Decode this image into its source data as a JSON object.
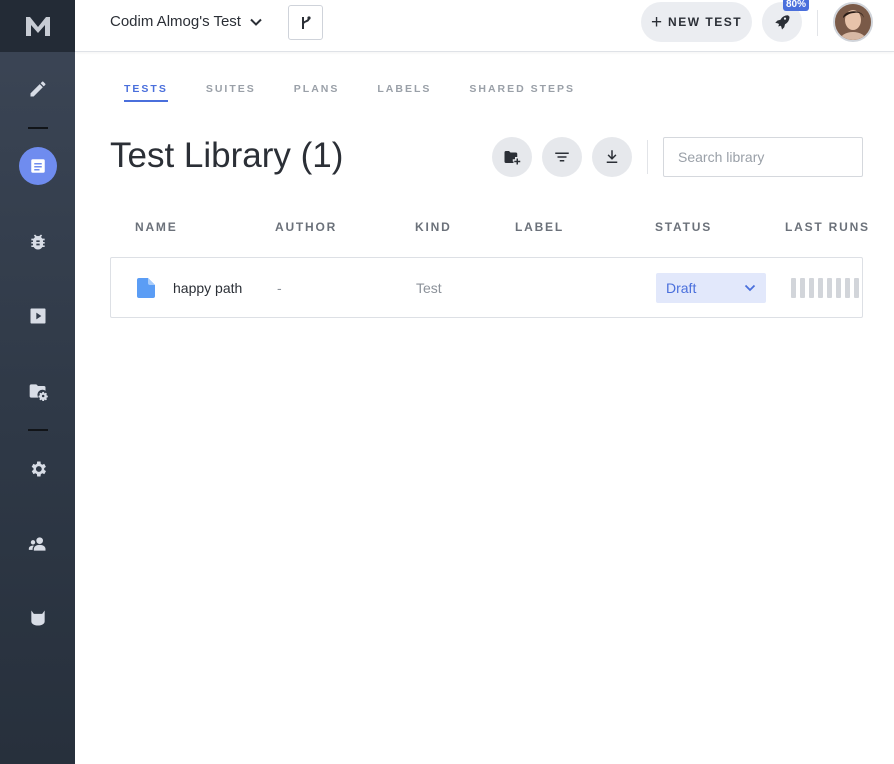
{
  "project": {
    "name": "Codim Almog's Test"
  },
  "topbar": {
    "new_test_label": "NEW TEST",
    "progress_badge": "80%"
  },
  "tabs": [
    {
      "label": "TESTS",
      "active": true
    },
    {
      "label": "SUITES",
      "active": false
    },
    {
      "label": "PLANS",
      "active": false
    },
    {
      "label": "LABELS",
      "active": false
    },
    {
      "label": "SHARED STEPS",
      "active": false
    }
  ],
  "page": {
    "title": "Test Library (1)"
  },
  "search": {
    "placeholder": "Search library"
  },
  "table": {
    "columns": [
      "NAME",
      "AUTHOR",
      "KIND",
      "LABEL",
      "STATUS",
      "LAST RUNS"
    ],
    "rows": [
      {
        "name": "happy path",
        "author": "-",
        "kind": "Test",
        "label": "",
        "status": "Draft",
        "last_runs_count": 8
      }
    ]
  },
  "icons": {
    "sidebar": [
      "pencil-icon",
      "library-icon",
      "bug-icon",
      "play-icon",
      "folder-settings-icon",
      "gear-icon",
      "users-icon",
      "mask-icon"
    ],
    "toolbar": [
      "add-folder-icon",
      "filter-icon",
      "download-icon"
    ]
  },
  "colors": {
    "accent": "#4a6fdc",
    "active_nav": "#6f8cef",
    "sidebar": "#2f3947"
  }
}
